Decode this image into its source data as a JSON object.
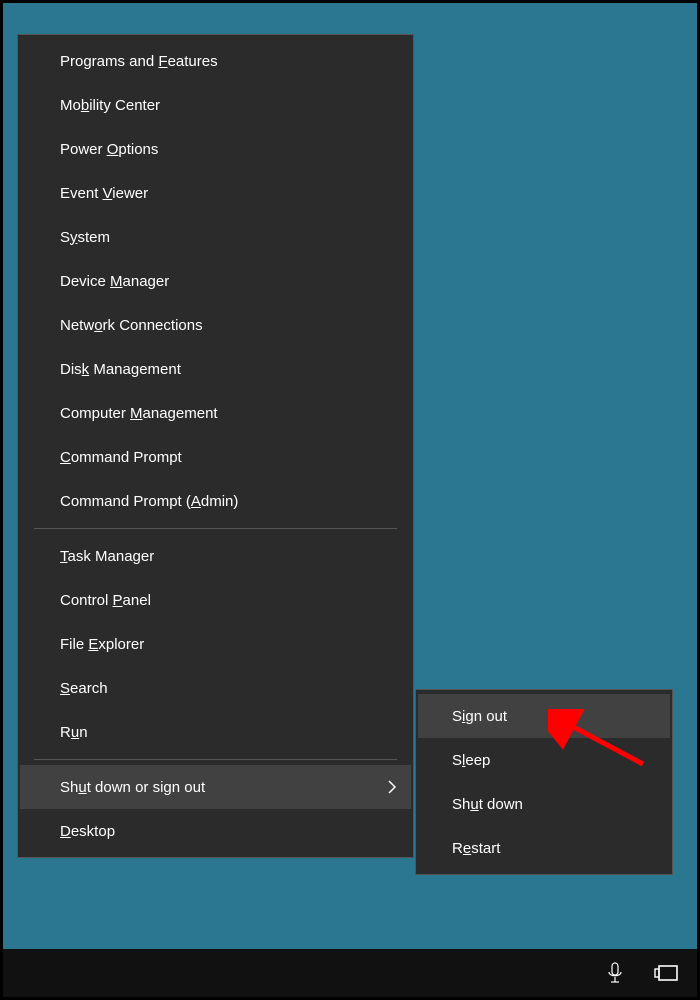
{
  "colors": {
    "desktop": "#2b7690",
    "menu_bg": "#2b2b2b",
    "menu_border": "#555555",
    "highlight_bg": "#414141",
    "annotation": "#ff0000"
  },
  "main_menu": {
    "groups": [
      [
        {
          "label": "Programs and Features",
          "accel_index": 13
        },
        {
          "label": "Mobility Center",
          "accel_index": 2
        },
        {
          "label": "Power Options",
          "accel_index": 6
        },
        {
          "label": "Event Viewer",
          "accel_index": 6
        },
        {
          "label": "System",
          "accel_index": 1
        },
        {
          "label": "Device Manager",
          "accel_index": 7
        },
        {
          "label": "Network Connections",
          "accel_index": 4
        },
        {
          "label": "Disk Management",
          "accel_index": 3
        },
        {
          "label": "Computer Management",
          "accel_index": 9
        },
        {
          "label": "Command Prompt",
          "accel_index": 0
        },
        {
          "label": "Command Prompt (Admin)",
          "accel_index": 16
        }
      ],
      [
        {
          "label": "Task Manager",
          "accel_index": 0
        },
        {
          "label": "Control Panel",
          "accel_index": 8
        },
        {
          "label": "File Explorer",
          "accel_index": 5
        },
        {
          "label": "Search",
          "accel_index": 0
        },
        {
          "label": "Run",
          "accel_index": 1
        }
      ],
      [
        {
          "label": "Shut down or sign out",
          "accel_index": 2,
          "submenu": true,
          "highlight": true
        },
        {
          "label": "Desktop",
          "accel_index": 0
        }
      ]
    ]
  },
  "submenu": {
    "items": [
      {
        "label": "Sign out",
        "accel_index": 1,
        "highlight": true
      },
      {
        "label": "Sleep",
        "accel_index": 1
      },
      {
        "label": "Shut down",
        "accel_index": 2
      },
      {
        "label": "Restart",
        "accel_index": 1
      }
    ]
  },
  "taskbar": {
    "icons": [
      "microphone-icon",
      "task-view-icon"
    ]
  }
}
